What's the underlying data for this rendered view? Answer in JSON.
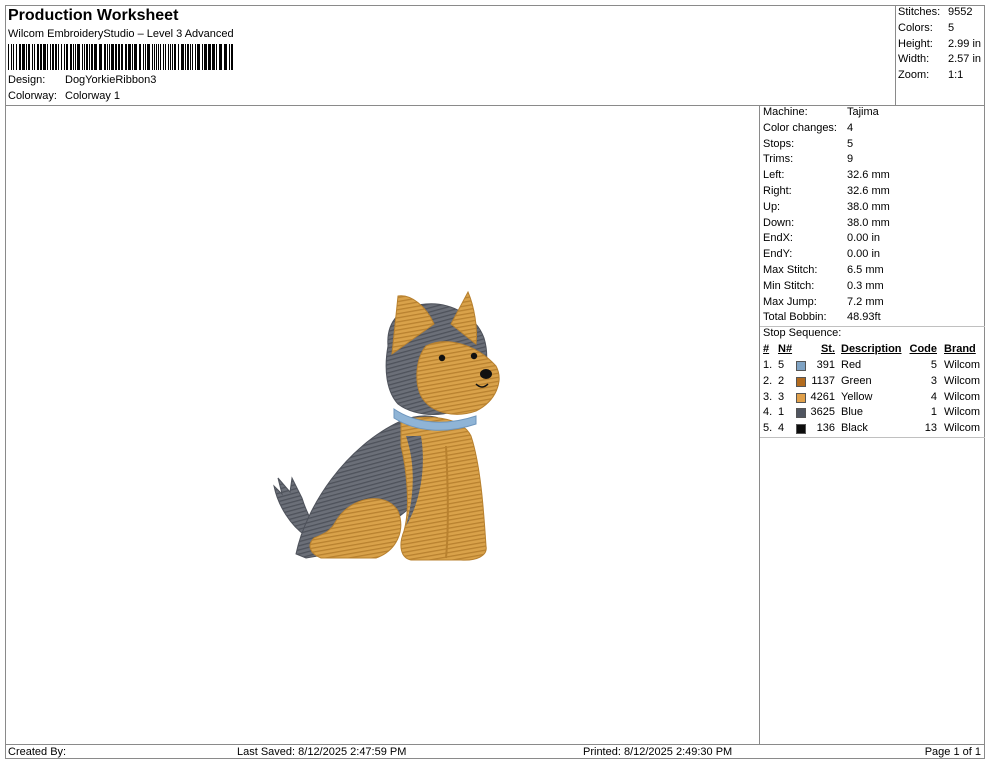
{
  "header": {
    "title": "Production Worksheet",
    "subtitle": "Wilcom EmbroideryStudio – Level 3 Advanced",
    "design_label": "Design:",
    "design_value": "DogYorkieRibbon3",
    "colorway_label": "Colorway:",
    "colorway_value": "Colorway 1"
  },
  "stats": [
    {
      "label": "Stitches:",
      "value": "9552"
    },
    {
      "label": "Colors:",
      "value": "5"
    },
    {
      "label": "Height:",
      "value": "2.99 in"
    },
    {
      "label": "Width:",
      "value": "2.57 in"
    },
    {
      "label": "Zoom:",
      "value": "1:1"
    }
  ],
  "machine_info": [
    {
      "label": "Machine:",
      "value": "Tajima"
    },
    {
      "label": "Color changes:",
      "value": "4"
    },
    {
      "label": "Stops:",
      "value": "5"
    },
    {
      "label": "Trims:",
      "value": "9"
    },
    {
      "label": "Left:",
      "value": "32.6 mm"
    },
    {
      "label": "Right:",
      "value": "32.6 mm"
    },
    {
      "label": "Up:",
      "value": "38.0 mm"
    },
    {
      "label": "Down:",
      "value": "38.0 mm"
    },
    {
      "label": "EndX:",
      "value": "0.00 in"
    },
    {
      "label": "EndY:",
      "value": "0.00 in"
    },
    {
      "label": "Max Stitch:",
      "value": "6.5 mm"
    },
    {
      "label": "Min Stitch:",
      "value": "0.3 mm"
    },
    {
      "label": "Max Jump:",
      "value": "7.2 mm"
    },
    {
      "label": "Total Bobbin:",
      "value": "48.93ft"
    }
  ],
  "stop_sequence": {
    "title": "Stop Sequence:",
    "headers": {
      "num": "#",
      "n": "N#",
      "st": "St.",
      "desc": "Description",
      "code": "Code",
      "brand": "Brand"
    },
    "rows": [
      {
        "num": "1.",
        "n": "5",
        "color": "#7fa3c4",
        "st": "391",
        "desc": "Red",
        "code": "5",
        "brand": "Wilcom"
      },
      {
        "num": "2.",
        "n": "2",
        "color": "#b26b1e",
        "st": "1137",
        "desc": "Green",
        "code": "3",
        "brand": "Wilcom"
      },
      {
        "num": "3.",
        "n": "3",
        "color": "#e0a04a",
        "st": "4261",
        "desc": "Yellow",
        "code": "4",
        "brand": "Wilcom"
      },
      {
        "num": "4.",
        "n": "1",
        "color": "#505560",
        "st": "3625",
        "desc": "Blue",
        "code": "1",
        "brand": "Wilcom"
      },
      {
        "num": "5.",
        "n": "4",
        "color": "#0d0d0d",
        "st": "136",
        "desc": "Black",
        "code": "13",
        "brand": "Wilcom"
      }
    ]
  },
  "footer": {
    "created_by": "Created By:",
    "last_saved": "Last Saved: 8/12/2025 2:47:59 PM",
    "printed": "Printed: 8/12/2025 2:49:30 PM",
    "page": "Page 1 of 1"
  },
  "colors": {
    "fur_tan": "#d9a24a",
    "fur_tan_dark": "#b8812f",
    "fur_gray": "#6b6f78",
    "fur_gray_dark": "#4e525b",
    "collar": "#8fb4d6",
    "nose": "#111111"
  }
}
